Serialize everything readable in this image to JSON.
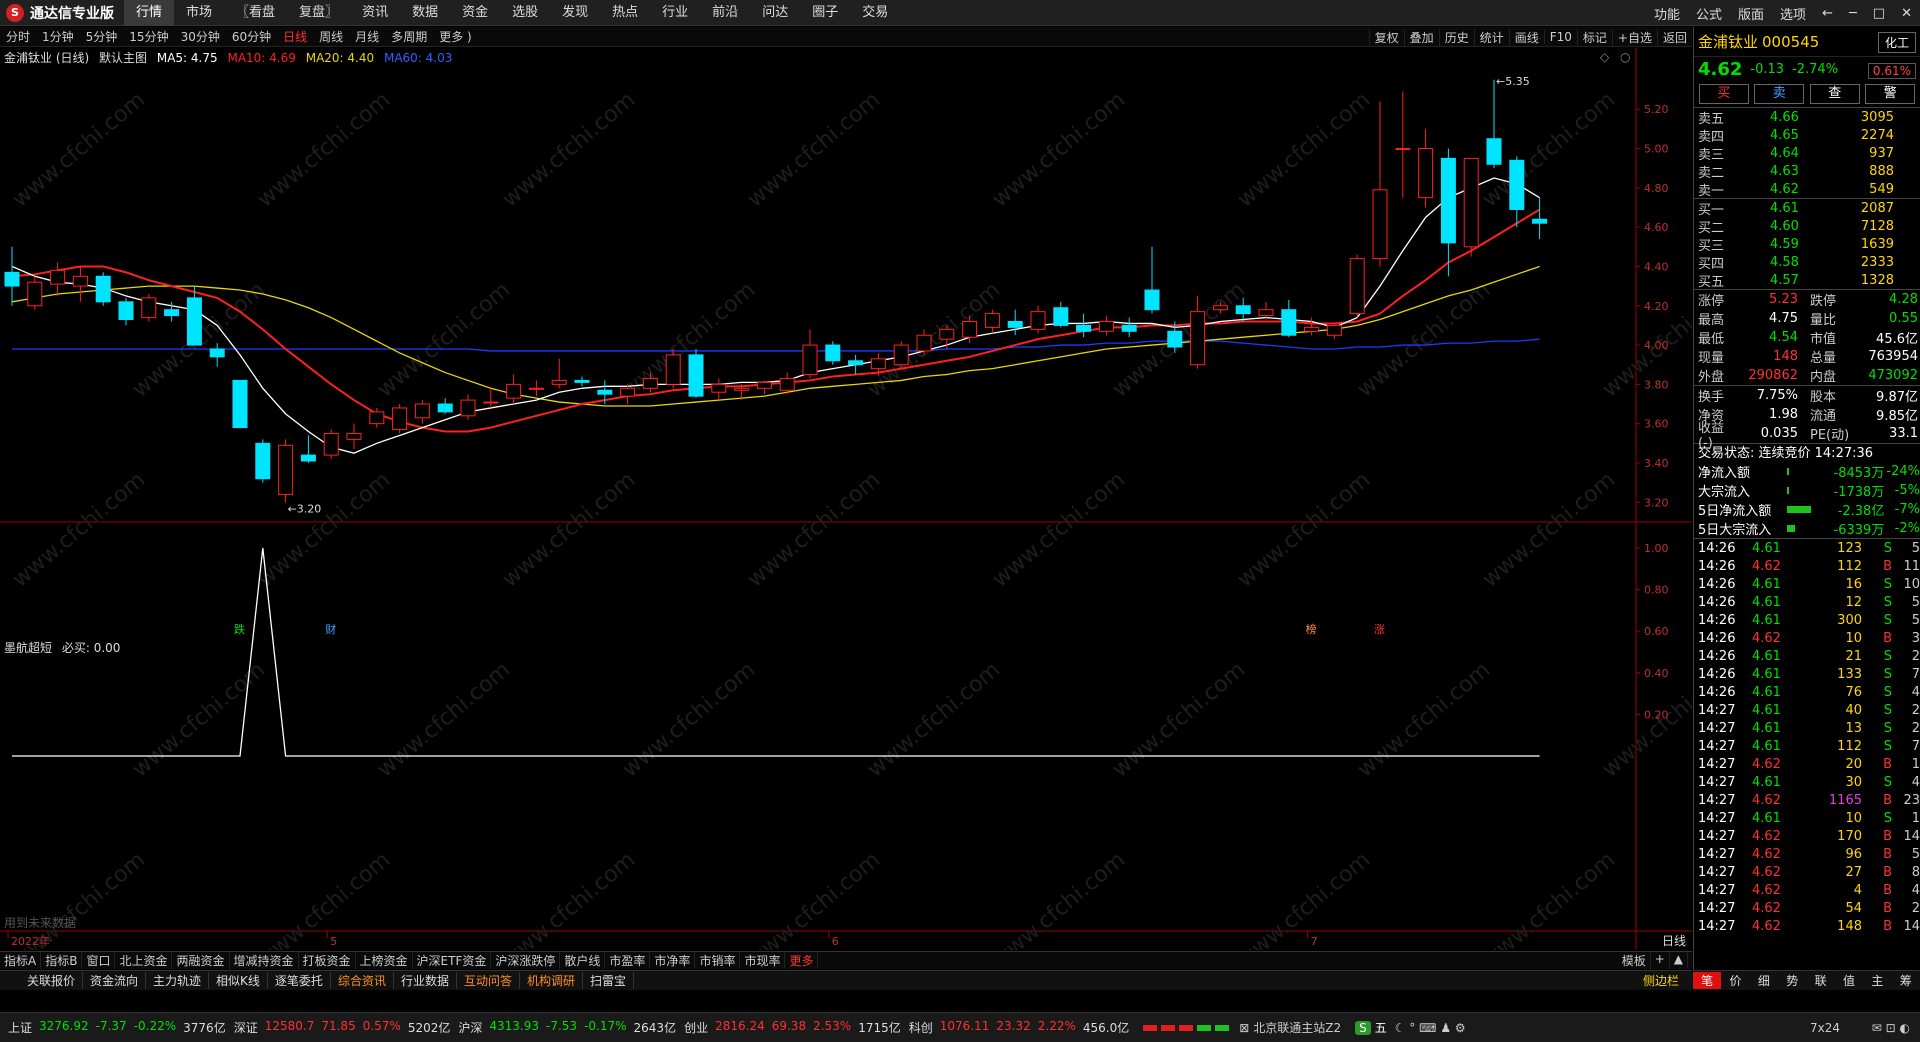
{
  "app": {
    "logo_letter": "S",
    "name": "通达信专业版"
  },
  "menu": [
    "行情",
    "市场",
    "〖看盘",
    "复盘〗",
    "资讯",
    "数据",
    "资金",
    "选股",
    "发现",
    "热点",
    "行业",
    "前沿",
    "问达",
    "圈子",
    "交易"
  ],
  "menu_active": 0,
  "topright": [
    "功能",
    "公式",
    "版面",
    "选项",
    "←",
    "─",
    "□",
    "✕"
  ],
  "periods": [
    "分时",
    "1分钟",
    "5分钟",
    "15分钟",
    "30分钟",
    "60分钟",
    "日线",
    "周线",
    "月线",
    "多周期",
    "更多 )"
  ],
  "period_active": 6,
  "tools": [
    "复权",
    "叠加",
    "历史",
    "统计",
    "画线",
    "F10",
    "标记",
    "+自选",
    "返回"
  ],
  "main_legend": {
    "title": "金浦钛业 (日线)",
    "mode": "默认主图",
    "ma5": "MA5: 4.75",
    "ma10": "MA10: 4.69",
    "ma20": "MA20: 4.40",
    "ma60": "MA60: 4.03"
  },
  "sub_legend": {
    "title": "墨航超短",
    "value": "必买: 0.00",
    "footnote": "用到未来数据"
  },
  "time_labels": [
    "2022年",
    "5",
    "6",
    "7"
  ],
  "corner_label": "日线",
  "marks": [
    {
      "text": "跌",
      "index": 10,
      "color": "#00e000"
    },
    {
      "text": "财",
      "index": 14,
      "color": "#40a0ff"
    },
    {
      "text": "榜",
      "index": 57,
      "color": "#ff9020"
    },
    {
      "text": "涨",
      "index": 60,
      "color": "#ff3030"
    }
  ],
  "annotations": {
    "high": "5.35",
    "low": "3.20"
  },
  "chart_data": {
    "type": "candlestick",
    "ylim_main": [
      3.12,
      5.42
    ],
    "y_ticks_main": [
      "5.20",
      "5.00",
      "4.80",
      "4.60",
      "4.40",
      "4.20",
      "4.00",
      "3.80",
      "3.60",
      "3.40",
      "3.20"
    ],
    "ylim_sub": [
      0,
      1.0
    ],
    "y_ticks_sub": [
      "1.00",
      "0.80",
      "0.60",
      "0.40",
      "0.20"
    ],
    "candles": [
      {
        "o": 4.37,
        "h": 4.5,
        "l": 4.2,
        "c": 4.3
      },
      {
        "o": 4.2,
        "h": 4.35,
        "l": 4.18,
        "c": 4.32
      },
      {
        "o": 4.31,
        "h": 4.42,
        "l": 4.25,
        "c": 4.38
      },
      {
        "o": 4.3,
        "h": 4.4,
        "l": 4.22,
        "c": 4.35
      },
      {
        "o": 4.35,
        "h": 4.37,
        "l": 4.2,
        "c": 4.22
      },
      {
        "o": 4.22,
        "h": 4.24,
        "l": 4.1,
        "c": 4.13
      },
      {
        "o": 4.14,
        "h": 4.26,
        "l": 4.12,
        "c": 4.24
      },
      {
        "o": 4.18,
        "h": 4.22,
        "l": 4.12,
        "c": 4.15
      },
      {
        "o": 4.24,
        "h": 4.3,
        "l": 4.1,
        "c": 4.0
      },
      {
        "o": 3.98,
        "h": 4.01,
        "l": 3.89,
        "c": 3.94
      },
      {
        "o": 3.82,
        "h": 3.82,
        "l": 3.58,
        "c": 3.58
      },
      {
        "o": 3.5,
        "h": 3.52,
        "l": 3.3,
        "c": 3.32
      },
      {
        "o": 3.24,
        "h": 3.52,
        "l": 3.2,
        "c": 3.49
      },
      {
        "o": 3.44,
        "h": 3.54,
        "l": 3.4,
        "c": 3.41
      },
      {
        "o": 3.44,
        "h": 3.57,
        "l": 3.42,
        "c": 3.55
      },
      {
        "o": 3.52,
        "h": 3.6,
        "l": 3.47,
        "c": 3.55
      },
      {
        "o": 3.6,
        "h": 3.68,
        "l": 3.58,
        "c": 3.66
      },
      {
        "o": 3.57,
        "h": 3.7,
        "l": 3.55,
        "c": 3.68
      },
      {
        "o": 3.63,
        "h": 3.72,
        "l": 3.6,
        "c": 3.7
      },
      {
        "o": 3.7,
        "h": 3.73,
        "l": 3.65,
        "c": 3.66
      },
      {
        "o": 3.64,
        "h": 3.75,
        "l": 3.62,
        "c": 3.72
      },
      {
        "o": 3.71,
        "h": 3.78,
        "l": 3.68,
        "c": 3.71
      },
      {
        "o": 3.73,
        "h": 3.85,
        "l": 3.7,
        "c": 3.8
      },
      {
        "o": 3.78,
        "h": 3.82,
        "l": 3.74,
        "c": 3.78
      },
      {
        "o": 3.8,
        "h": 3.93,
        "l": 3.78,
        "c": 3.82
      },
      {
        "o": 3.82,
        "h": 3.84,
        "l": 3.79,
        "c": 3.81
      },
      {
        "o": 3.77,
        "h": 3.82,
        "l": 3.7,
        "c": 3.75
      },
      {
        "o": 3.74,
        "h": 3.8,
        "l": 3.7,
        "c": 3.78
      },
      {
        "o": 3.78,
        "h": 3.86,
        "l": 3.76,
        "c": 3.83
      },
      {
        "o": 3.8,
        "h": 3.98,
        "l": 3.78,
        "c": 3.95
      },
      {
        "o": 3.95,
        "h": 3.98,
        "l": 3.73,
        "c": 3.74
      },
      {
        "o": 3.76,
        "h": 3.83,
        "l": 3.72,
        "c": 3.8
      },
      {
        "o": 3.77,
        "h": 3.8,
        "l": 3.72,
        "c": 3.78
      },
      {
        "o": 3.78,
        "h": 3.82,
        "l": 3.75,
        "c": 3.81
      },
      {
        "o": 3.77,
        "h": 3.86,
        "l": 3.75,
        "c": 3.83
      },
      {
        "o": 3.85,
        "h": 4.08,
        "l": 3.83,
        "c": 4.0
      },
      {
        "o": 4.0,
        "h": 4.02,
        "l": 3.9,
        "c": 3.92
      },
      {
        "o": 3.92,
        "h": 3.95,
        "l": 3.85,
        "c": 3.9
      },
      {
        "o": 3.88,
        "h": 3.96,
        "l": 3.84,
        "c": 3.93
      },
      {
        "o": 3.9,
        "h": 4.02,
        "l": 3.88,
        "c": 4.0
      },
      {
        "o": 3.97,
        "h": 4.08,
        "l": 3.95,
        "c": 4.05
      },
      {
        "o": 4.03,
        "h": 4.1,
        "l": 3.98,
        "c": 4.08
      },
      {
        "o": 4.04,
        "h": 4.15,
        "l": 4.01,
        "c": 4.12
      },
      {
        "o": 4.09,
        "h": 4.18,
        "l": 4.06,
        "c": 4.16
      },
      {
        "o": 4.12,
        "h": 4.18,
        "l": 4.05,
        "c": 4.09
      },
      {
        "o": 4.08,
        "h": 4.2,
        "l": 4.06,
        "c": 4.17
      },
      {
        "o": 4.19,
        "h": 4.22,
        "l": 4.09,
        "c": 4.1
      },
      {
        "o": 4.1,
        "h": 4.16,
        "l": 4.04,
        "c": 4.07
      },
      {
        "o": 4.07,
        "h": 4.15,
        "l": 4.05,
        "c": 4.12
      },
      {
        "o": 4.1,
        "h": 4.14,
        "l": 4.04,
        "c": 4.07
      },
      {
        "o": 4.28,
        "h": 4.5,
        "l": 4.16,
        "c": 4.18
      },
      {
        "o": 4.07,
        "h": 4.12,
        "l": 3.96,
        "c": 3.99
      },
      {
        "o": 3.9,
        "h": 4.25,
        "l": 3.88,
        "c": 4.17
      },
      {
        "o": 4.18,
        "h": 4.22,
        "l": 4.16,
        "c": 4.2
      },
      {
        "o": 4.2,
        "h": 4.24,
        "l": 4.12,
        "c": 4.16
      },
      {
        "o": 4.15,
        "h": 4.22,
        "l": 4.13,
        "c": 4.18
      },
      {
        "o": 4.18,
        "h": 4.23,
        "l": 4.04,
        "c": 4.05
      },
      {
        "o": 4.07,
        "h": 4.14,
        "l": 4.05,
        "c": 4.09
      },
      {
        "o": 4.05,
        "h": 4.11,
        "l": 4.03,
        "c": 4.1
      },
      {
        "o": 4.16,
        "h": 4.46,
        "l": 4.14,
        "c": 4.44
      },
      {
        "o": 4.44,
        "h": 5.24,
        "l": 4.4,
        "c": 4.79
      },
      {
        "o": 5.0,
        "h": 5.29,
        "l": 4.75,
        "c": 5.0
      },
      {
        "o": 4.75,
        "h": 5.1,
        "l": 4.7,
        "c": 5.0
      },
      {
        "o": 4.95,
        "h": 5.0,
        "l": 4.35,
        "c": 4.52
      },
      {
        "o": 4.5,
        "h": 4.95,
        "l": 4.45,
        "c": 4.95
      },
      {
        "o": 5.05,
        "h": 5.35,
        "l": 4.9,
        "c": 4.92
      },
      {
        "o": 4.94,
        "h": 4.96,
        "l": 4.6,
        "c": 4.69
      },
      {
        "o": 4.64,
        "h": 4.75,
        "l": 4.54,
        "c": 4.62
      }
    ],
    "ma5": [
      4.4,
      4.35,
      4.32,
      4.31,
      4.29,
      4.25,
      4.22,
      4.2,
      4.18,
      4.1,
      3.95,
      3.78,
      3.65,
      3.56,
      3.48,
      3.45,
      3.5,
      3.54,
      3.58,
      3.62,
      3.66,
      3.68,
      3.7,
      3.72,
      3.76,
      3.78,
      3.79,
      3.79,
      3.8,
      3.8,
      3.8,
      3.8,
      3.81,
      3.81,
      3.82,
      3.86,
      3.88,
      3.9,
      3.92,
      3.94,
      3.97,
      4.0,
      4.04,
      4.06,
      4.08,
      4.1,
      4.11,
      4.11,
      4.12,
      4.11,
      4.11,
      4.09,
      4.1,
      4.12,
      4.13,
      4.14,
      4.13,
      4.12,
      4.09,
      4.14,
      4.3,
      4.48,
      4.65,
      4.75,
      4.8,
      4.85,
      4.82,
      4.75
    ],
    "ma10": [
      4.35,
      4.36,
      4.38,
      4.4,
      4.4,
      4.37,
      4.33,
      4.3,
      4.27,
      4.24,
      4.17,
      4.08,
      3.98,
      3.89,
      3.8,
      3.72,
      3.65,
      3.61,
      3.58,
      3.56,
      3.56,
      3.58,
      3.61,
      3.64,
      3.67,
      3.7,
      3.72,
      3.74,
      3.75,
      3.77,
      3.78,
      3.79,
      3.79,
      3.8,
      3.81,
      3.82,
      3.84,
      3.85,
      3.86,
      3.88,
      3.9,
      3.92,
      3.94,
      3.97,
      4.0,
      4.03,
      4.05,
      4.07,
      4.09,
      4.09,
      4.1,
      4.1,
      4.11,
      4.11,
      4.12,
      4.12,
      4.12,
      4.11,
      4.11,
      4.12,
      4.16,
      4.25,
      4.33,
      4.42,
      4.48,
      4.55,
      4.62,
      4.69
    ],
    "ma20": [
      4.22,
      4.24,
      4.26,
      4.27,
      4.28,
      4.29,
      4.3,
      4.3,
      4.3,
      4.29,
      4.28,
      4.26,
      4.23,
      4.19,
      4.14,
      4.08,
      4.02,
      3.96,
      3.91,
      3.86,
      3.82,
      3.78,
      3.75,
      3.73,
      3.71,
      3.7,
      3.69,
      3.69,
      3.69,
      3.7,
      3.71,
      3.72,
      3.73,
      3.74,
      3.76,
      3.78,
      3.79,
      3.8,
      3.81,
      3.82,
      3.84,
      3.85,
      3.87,
      3.88,
      3.9,
      3.92,
      3.94,
      3.96,
      3.98,
      3.99,
      4.0,
      4.01,
      4.02,
      4.03,
      4.04,
      4.05,
      4.06,
      4.07,
      4.08,
      4.1,
      4.13,
      4.17,
      4.21,
      4.25,
      4.28,
      4.32,
      4.36,
      4.4
    ],
    "ma60": [
      3.98,
      3.98,
      3.98,
      3.98,
      3.98,
      3.98,
      3.98,
      3.98,
      3.98,
      3.98,
      3.98,
      3.98,
      3.98,
      3.98,
      3.98,
      3.98,
      3.98,
      3.98,
      3.98,
      3.98,
      3.98,
      3.97,
      3.97,
      3.97,
      3.97,
      3.97,
      3.97,
      3.97,
      3.97,
      3.97,
      3.97,
      3.97,
      3.97,
      3.97,
      3.97,
      3.97,
      3.97,
      3.97,
      3.97,
      3.97,
      3.97,
      3.98,
      3.98,
      3.98,
      3.99,
      3.99,
      4.0,
      4.0,
      4.01,
      4.01,
      4.02,
      4.02,
      4.02,
      4.02,
      4.01,
      4.0,
      3.99,
      3.98,
      3.98,
      3.99,
      3.99,
      4.0,
      4.0,
      4.01,
      4.01,
      4.02,
      4.02,
      4.03
    ],
    "signal": [
      0,
      0,
      0,
      0,
      0,
      0,
      0,
      0,
      0,
      0,
      0,
      1,
      0,
      0,
      0,
      0,
      0,
      0,
      0,
      0,
      0,
      0,
      0,
      0,
      0,
      0,
      0,
      0,
      0,
      0,
      0,
      0,
      0,
      0,
      0,
      0,
      0,
      0,
      0,
      0,
      0,
      0,
      0,
      0,
      0,
      0,
      0,
      0,
      0,
      0,
      0,
      0,
      0,
      0,
      0,
      0,
      0,
      0,
      0,
      0,
      0,
      0,
      0,
      0,
      0,
      0,
      0,
      0
    ],
    "colors": {
      "up": "#ff2020",
      "down": "#00e5ff",
      "ma5": "#ffffff",
      "ma10": "#ff2020",
      "ma20": "#e8d800",
      "ma60": "#1a3cff",
      "axis": "#a00000"
    }
  },
  "stock": {
    "name": "金浦钛业",
    "code": "000545",
    "sector": "化工",
    "price": "4.62",
    "change": "-0.13",
    "pct": "-2.74%",
    "tag": "0.61%"
  },
  "actions": [
    "买",
    "卖",
    "查",
    "警"
  ],
  "asks": [
    {
      "label": "卖五",
      "price": "4.66",
      "vol": "3095"
    },
    {
      "label": "卖四",
      "price": "4.65",
      "vol": "2274"
    },
    {
      "label": "卖三",
      "price": "4.64",
      "vol": "937"
    },
    {
      "label": "卖二",
      "price": "4.63",
      "vol": "888"
    },
    {
      "label": "卖一",
      "price": "4.62",
      "vol": "549"
    }
  ],
  "bids": [
    {
      "label": "买一",
      "price": "4.61",
      "vol": "2087"
    },
    {
      "label": "买二",
      "price": "4.60",
      "vol": "7128"
    },
    {
      "label": "买三",
      "price": "4.59",
      "vol": "1639"
    },
    {
      "label": "买四",
      "price": "4.58",
      "vol": "2333"
    },
    {
      "label": "买五",
      "price": "4.57",
      "vol": "1328"
    }
  ],
  "stats": [
    {
      "k1": "涨停",
      "v1": "5.23",
      "c1": "red",
      "k2": "跌停",
      "v2": "4.28",
      "c2": "green"
    },
    {
      "k1": "最高",
      "v1": "4.75",
      "c1": "white",
      "k2": "量比",
      "v2": "0.55",
      "c2": "green"
    },
    {
      "k1": "最低",
      "v1": "4.54",
      "c1": "green",
      "k2": "市值",
      "v2": "45.6亿",
      "c2": "white"
    },
    {
      "k1": "现量",
      "v1": "148",
      "c1": "red",
      "k2": "总量",
      "v2": "763954",
      "c2": "white"
    },
    {
      "k1": "外盘",
      "v1": "290862",
      "c1": "red",
      "k2": "内盘",
      "v2": "473092",
      "c2": "green"
    }
  ],
  "stats2": [
    {
      "k1": "换手",
      "v1": "7.75%",
      "c1": "white",
      "k2": "股本",
      "v2": "9.87亿",
      "c2": "white"
    },
    {
      "k1": "净资",
      "v1": "1.98",
      "c1": "white",
      "k2": "流通",
      "v2": "9.85亿",
      "c2": "white"
    },
    {
      "k1": "收益(-)",
      "v1": "0.035",
      "c1": "white",
      "k2": "PE(动)",
      "v2": "33.1",
      "c2": "white"
    }
  ],
  "trade_state": "交易状态: 连续竞价 14:27:36",
  "flows": [
    {
      "k": "净流入额",
      "v": "-8453万",
      "pc": "-24%",
      "fill": 0.05
    },
    {
      "k": "大宗流入",
      "v": "-1738万",
      "pc": "-5%",
      "fill": 0.02
    },
    {
      "k": "5日净流入额",
      "v": "-2.38亿",
      "pc": "-7%",
      "fill": 0.8
    },
    {
      "k": "5日大宗流入",
      "v": "-6339万",
      "pc": "-2%",
      "fill": 0.25
    }
  ],
  "trades": [
    {
      "t": "14:26",
      "p": "4.61",
      "v": "123",
      "bs": "S",
      "n": "5"
    },
    {
      "t": "14:26",
      "p": "4.62",
      "v": "112",
      "bs": "B",
      "n": "11"
    },
    {
      "t": "14:26",
      "p": "4.61",
      "v": "16",
      "bs": "S",
      "n": "10"
    },
    {
      "t": "14:26",
      "p": "4.61",
      "v": "12",
      "bs": "S",
      "n": "5"
    },
    {
      "t": "14:26",
      "p": "4.61",
      "v": "300",
      "bs": "S",
      "n": "5"
    },
    {
      "t": "14:26",
      "p": "4.62",
      "v": "10",
      "bs": "B",
      "n": "3"
    },
    {
      "t": "14:26",
      "p": "4.61",
      "v": "21",
      "bs": "S",
      "n": "2"
    },
    {
      "t": "14:26",
      "p": "4.61",
      "v": "133",
      "bs": "S",
      "n": "7"
    },
    {
      "t": "14:26",
      "p": "4.61",
      "v": "76",
      "bs": "S",
      "n": "4"
    },
    {
      "t": "14:27",
      "p": "4.61",
      "v": "40",
      "bs": "S",
      "n": "2"
    },
    {
      "t": "14:27",
      "p": "4.61",
      "v": "13",
      "bs": "S",
      "n": "2"
    },
    {
      "t": "14:27",
      "p": "4.61",
      "v": "112",
      "bs": "S",
      "n": "7"
    },
    {
      "t": "14:27",
      "p": "4.62",
      "v": "20",
      "bs": "B",
      "n": "1"
    },
    {
      "t": "14:27",
      "p": "4.61",
      "v": "30",
      "bs": "S",
      "n": "4"
    },
    {
      "t": "14:27",
      "p": "4.62",
      "v": "1165",
      "bs": "B",
      "n": "23"
    },
    {
      "t": "14:27",
      "p": "4.61",
      "v": "10",
      "bs": "S",
      "n": "1"
    },
    {
      "t": "14:27",
      "p": "4.62",
      "v": "170",
      "bs": "B",
      "n": "14"
    },
    {
      "t": "14:27",
      "p": "4.62",
      "v": "96",
      "bs": "B",
      "n": "5"
    },
    {
      "t": "14:27",
      "p": "4.62",
      "v": "27",
      "bs": "B",
      "n": "8"
    },
    {
      "t": "14:27",
      "p": "4.62",
      "v": "4",
      "bs": "B",
      "n": "4"
    },
    {
      "t": "14:27",
      "p": "4.62",
      "v": "54",
      "bs": "B",
      "n": "2"
    },
    {
      "t": "14:27",
      "p": "4.62",
      "v": "148",
      "bs": "B",
      "n": "14"
    }
  ],
  "tabs1": [
    "指标A",
    "指标B",
    "窗口",
    "北上资金",
    "两融资金",
    "增减持资金",
    "打板资金",
    "上榜资金",
    "沪深ETF资金",
    "沪深涨跌停",
    "散户线",
    "市盈率",
    "市净率",
    "市销率",
    "市现率",
    "更多"
  ],
  "tabs1_right": [
    "模板",
    "+",
    "▲"
  ],
  "tabs2": [
    "关联报价",
    "资金流向",
    "主力轨迹",
    "相似K线",
    "逐笔委托",
    "综合资讯",
    "行业数据",
    "互动问答",
    "机构调研",
    "扫雷宝"
  ],
  "tabs2_side": "侧边栏",
  "rtabs": [
    "笔",
    "价",
    "细",
    "势",
    "联",
    "值",
    "主",
    "筹"
  ],
  "status": [
    {
      "name": "上证",
      "val": "3276.92",
      "chg": "-7.37",
      "pct": "-0.22%",
      "amt": "3776亿",
      "up": false
    },
    {
      "name": "深证",
      "val": "12580.7",
      "chg": "71.85",
      "pct": "0.57%",
      "amt": "5202亿",
      "up": true
    },
    {
      "name": "沪深",
      "val": "4313.93",
      "chg": "-7.53",
      "pct": "-0.17%",
      "amt": "2643亿",
      "up": false
    },
    {
      "name": "创业",
      "val": "2816.24",
      "chg": "69.38",
      "pct": "2.53%",
      "amt": "1715亿",
      "up": true
    },
    {
      "name": "科创",
      "val": "1076.11",
      "chg": "23.32",
      "pct": "2.22%",
      "amt": "456.0亿",
      "up": true
    }
  ],
  "status_right": {
    "server": "北京联通主站Z2",
    "ime": "五",
    "clock": "7x24"
  },
  "watermark": "www.cfchi.com"
}
